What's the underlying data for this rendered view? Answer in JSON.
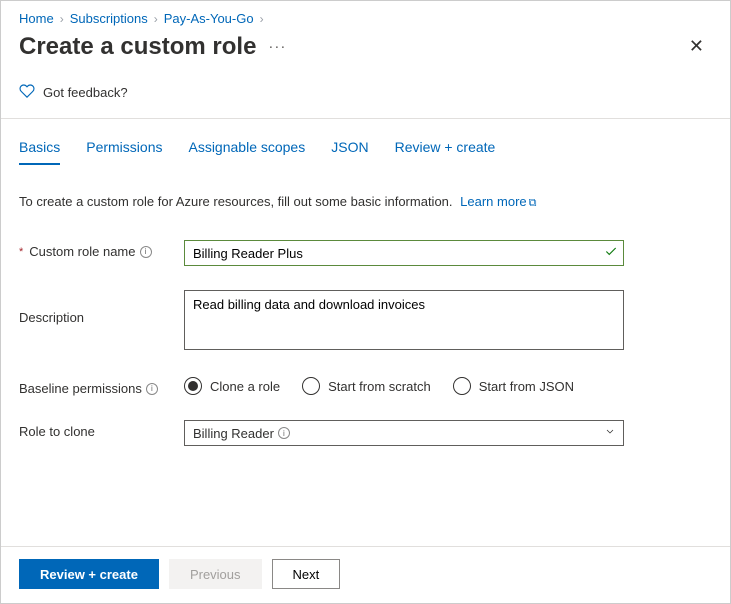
{
  "breadcrumb": {
    "items": [
      {
        "label": "Home"
      },
      {
        "label": "Subscriptions"
      },
      {
        "label": "Pay-As-You-Go"
      }
    ]
  },
  "title": "Create a custom role",
  "feedback_label": "Got feedback?",
  "tabs": [
    {
      "label": "Basics",
      "active": true
    },
    {
      "label": "Permissions"
    },
    {
      "label": "Assignable scopes"
    },
    {
      "label": "JSON"
    },
    {
      "label": "Review + create"
    }
  ],
  "intro_text": "To create a custom role for Azure resources, fill out some basic information.",
  "learn_more": "Learn more",
  "form": {
    "name_label": "Custom role name",
    "name_value": "Billing Reader Plus",
    "desc_label": "Description",
    "desc_value": "Read billing data and download invoices",
    "baseline_label": "Baseline permissions",
    "baseline_options": [
      {
        "label": "Clone a role",
        "checked": true
      },
      {
        "label": "Start from scratch",
        "checked": false
      },
      {
        "label": "Start from JSON",
        "checked": false
      }
    ],
    "clone_label": "Role to clone",
    "clone_value": "Billing Reader"
  },
  "footer": {
    "review": "Review + create",
    "previous": "Previous",
    "next": "Next"
  }
}
